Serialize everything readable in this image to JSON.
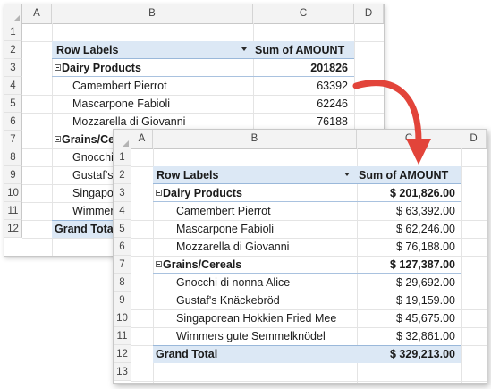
{
  "back": {
    "columns": [
      "A",
      "B",
      "C",
      "D"
    ],
    "rows": [
      "1",
      "2",
      "3",
      "4",
      "5",
      "6",
      "7",
      "8",
      "9",
      "10",
      "11",
      "12"
    ],
    "header": {
      "row_labels": "Row Labels",
      "sum": "Sum of AMOUNT"
    },
    "items": [
      {
        "label": "Dairy Products",
        "value": "201826"
      },
      {
        "label": "Camembert Pierrot",
        "value": "63392"
      },
      {
        "label": "Mascarpone Fabioli",
        "value": "62246"
      },
      {
        "label": "Mozzarella di Giovanni",
        "value": "76188"
      },
      {
        "label": "Grains/Cereals",
        "value": ""
      },
      {
        "label": "Gnocchi",
        "value": ""
      },
      {
        "label": "Gustaf's",
        "value": ""
      },
      {
        "label": "Singapo",
        "value": ""
      },
      {
        "label": "Wimmer",
        "value": ""
      },
      {
        "label": "Grand Total",
        "value": ""
      }
    ]
  },
  "front": {
    "columns": [
      "A",
      "B",
      "C",
      "D"
    ],
    "rows": [
      "1",
      "2",
      "3",
      "4",
      "5",
      "6",
      "7",
      "8",
      "9",
      "10",
      "11",
      "12",
      "13"
    ],
    "header": {
      "row_labels": "Row Labels",
      "sum": "Sum of AMOUNT"
    },
    "items": [
      {
        "label": "Dairy Products",
        "value": "$ 201,826.00"
      },
      {
        "label": "Camembert Pierrot",
        "value": "$ 63,392.00"
      },
      {
        "label": "Mascarpone Fabioli",
        "value": "$ 62,246.00"
      },
      {
        "label": "Mozzarella di Giovanni",
        "value": "$ 76,188.00"
      },
      {
        "label": "Grains/Cereals",
        "value": "$ 127,387.00"
      },
      {
        "label": "Gnocchi di nonna Alice",
        "value": "$ 29,692.00"
      },
      {
        "label": "Gustaf's Knäckebröd",
        "value": "$ 19,159.00"
      },
      {
        "label": "Singaporean Hokkien Fried Mee",
        "value": "$ 45,675.00"
      },
      {
        "label": "Wimmers gute Semmelknödel",
        "value": "$ 32,861.00"
      },
      {
        "label": "Grand Total",
        "value": "$ 329,213.00"
      }
    ]
  },
  "colors": {
    "accent_arrow": "#e2443a",
    "pivot_header_band": "#dce8f5"
  }
}
